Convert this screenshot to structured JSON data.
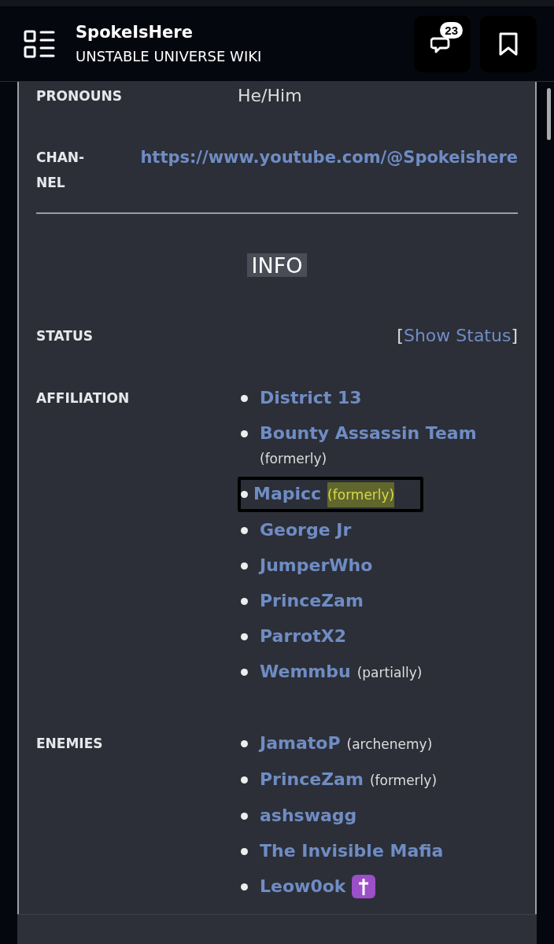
{
  "header": {
    "title": "SpokeIsHere",
    "subtitle": "UNSTABLE UNIVERSE WIKI",
    "comment_count": "23"
  },
  "top_rows": [
    {
      "label": "PRONOUNS",
      "value": "He/Him",
      "kind": "text"
    },
    {
      "label": "CHAN-\nNEL",
      "value": "https://www.youtube.com/@Spokeishere",
      "kind": "link"
    }
  ],
  "section_heading": "INFO",
  "status": {
    "label": "STATUS",
    "open_bracket": "[",
    "link": "Show Status",
    "close_bracket": "]"
  },
  "affiliation": {
    "label": "AFFILIATION",
    "items": [
      {
        "name": "District 13",
        "highlighted": false
      },
      {
        "name": "Bounty Assassin Team",
        "note": "(formerly)",
        "highlighted": false
      },
      {
        "name": "Mapicc",
        "note": "(formerly)",
        "highlighted": true
      },
      {
        "name": "George Jr",
        "highlighted": false
      },
      {
        "name": "JumperWho",
        "highlighted": false
      },
      {
        "name": "PrinceZam",
        "highlighted": false
      },
      {
        "name": "ParrotX2",
        "highlighted": false
      },
      {
        "name": "Wemmbu",
        "note": "(partially)",
        "highlighted": false
      }
    ]
  },
  "enemies": {
    "label": "ENEMIES",
    "items": [
      {
        "name": "JamatoP",
        "note": "(archenemy)",
        "deceased": false
      },
      {
        "name": "PrinceZam",
        "note": "(formerly)",
        "deceased": false
      },
      {
        "name": "ashswagg",
        "deceased": false
      },
      {
        "name": "The Invisible Mafia",
        "deceased": false
      },
      {
        "name": "Leow0ok",
        "deceased": true
      }
    ]
  }
}
